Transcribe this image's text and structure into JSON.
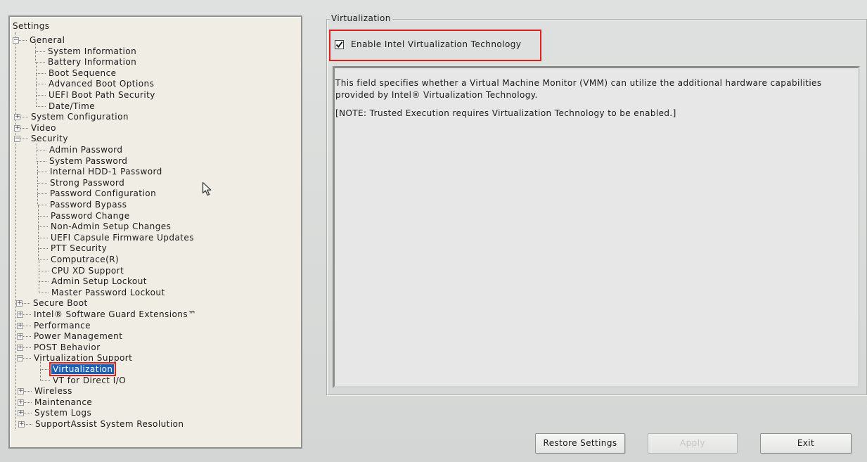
{
  "tree": {
    "root_label": "Settings",
    "items": [
      {
        "label": "General",
        "depth": 1,
        "expander": "minus"
      },
      {
        "label": "System Information",
        "depth": 2
      },
      {
        "label": "Battery Information",
        "depth": 2
      },
      {
        "label": "Boot Sequence",
        "depth": 2
      },
      {
        "label": "Advanced Boot Options",
        "depth": 2
      },
      {
        "label": "UEFI Boot Path Security",
        "depth": 2
      },
      {
        "label": "Date/Time",
        "depth": 2
      },
      {
        "label": "System Configuration",
        "depth": 1,
        "expander": "plus"
      },
      {
        "label": "Video",
        "depth": 1,
        "expander": "plus"
      },
      {
        "label": "Security",
        "depth": 1,
        "expander": "minus"
      },
      {
        "label": "Admin Password",
        "depth": 2
      },
      {
        "label": "System Password",
        "depth": 2
      },
      {
        "label": "Internal HDD-1 Password",
        "depth": 2
      },
      {
        "label": "Strong Password",
        "depth": 2
      },
      {
        "label": "Password Configuration",
        "depth": 2
      },
      {
        "label": "Password Bypass",
        "depth": 2
      },
      {
        "label": "Password Change",
        "depth": 2
      },
      {
        "label": "Non-Admin Setup Changes",
        "depth": 2
      },
      {
        "label": "UEFI Capsule Firmware Updates",
        "depth": 2
      },
      {
        "label": "PTT Security",
        "depth": 2
      },
      {
        "label": "Computrace(R)",
        "depth": 2
      },
      {
        "label": "CPU XD Support",
        "depth": 2
      },
      {
        "label": "Admin Setup Lockout",
        "depth": 2
      },
      {
        "label": "Master Password Lockout",
        "depth": 2
      },
      {
        "label": "Secure Boot",
        "depth": 1,
        "expander": "plus"
      },
      {
        "label": "Intel® Software Guard Extensions™",
        "depth": 1,
        "expander": "plus"
      },
      {
        "label": "Performance",
        "depth": 1,
        "expander": "plus"
      },
      {
        "label": "Power Management",
        "depth": 1,
        "expander": "plus"
      },
      {
        "label": "POST Behavior",
        "depth": 1,
        "expander": "plus"
      },
      {
        "label": "Virtualization Support",
        "depth": 1,
        "expander": "minus"
      },
      {
        "label": "Virtualization",
        "depth": 2,
        "selected": true
      },
      {
        "label": "VT for Direct I/O",
        "depth": 2
      },
      {
        "label": "Wireless",
        "depth": 1,
        "expander": "plus"
      },
      {
        "label": "Maintenance",
        "depth": 1,
        "expander": "plus"
      },
      {
        "label": "System Logs",
        "depth": 1,
        "expander": "plus"
      },
      {
        "label": "SupportAssist System Resolution",
        "depth": 1,
        "expander": "plus"
      }
    ]
  },
  "detail": {
    "group_title": "Virtualization",
    "checkbox_label": "Enable Intel Virtualization Technology",
    "checkbox_checked": true,
    "description_lines": [
      "This field specifies whether a Virtual Machine Monitor (VMM) can utilize the additional hardware capabilities",
      "provided by Intel® Virtualization Technology.",
      "[NOTE: Trusted Execution requires Virtualization Technology to be enabled.]"
    ]
  },
  "buttons": {
    "restore": "Restore Settings",
    "apply": "Apply",
    "exit": "Exit"
  },
  "colors": {
    "highlight_red": "#e02020",
    "selection_blue": "#1d5fb3"
  }
}
